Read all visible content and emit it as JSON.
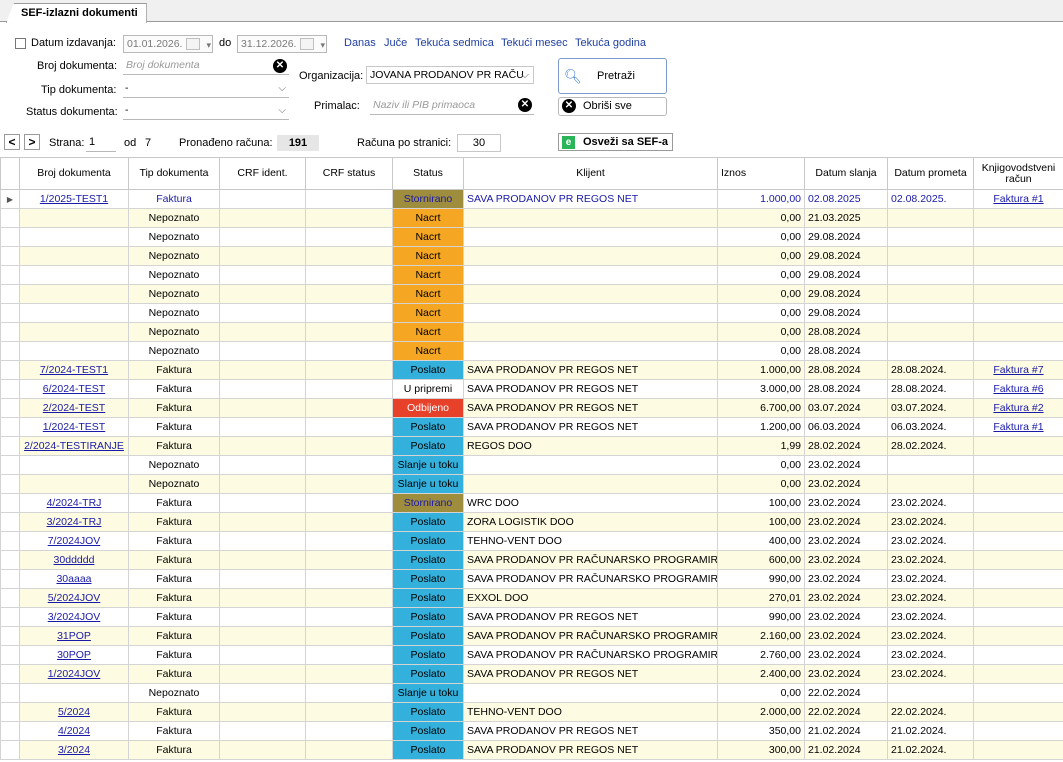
{
  "tab_title": "SEF-izlazni dokumenti",
  "filters": {
    "date_checkbox_label": "Datum izdavanja:",
    "date_from": "01.01.2026.",
    "date_to_label": "do",
    "date_to": "31.12.2026.",
    "quick_links": [
      "Danas",
      "Juče",
      "Tekuća sedmica",
      "Tekući mesec",
      "Tekuća godina"
    ],
    "doc_number_label": "Broj dokumenta:",
    "doc_number_placeholder": "Broj dokumenta",
    "doc_type_label": "Tip dokumenta:",
    "doc_type_value": "-",
    "doc_status_label": "Status dokumenta:",
    "doc_status_value": "-",
    "org_label": "Organizacija:",
    "org_value": "JOVANA PRODANOV PR RAČU",
    "recipient_label": "Primalac:",
    "recipient_placeholder": "Naziv ili PIB primaoca",
    "search_button": "Pretraži",
    "clear_all_button": "Obriši sve"
  },
  "toolbar": {
    "page_label": "Strana:",
    "page_value": "1",
    "of_label": "od",
    "total_pages": "7",
    "found_label": "Pronađeno računa:",
    "found_count": "191",
    "per_page_label": "Računa po stranici:",
    "per_page_value": "30",
    "refresh_button": "Osveži sa SEF-a",
    "colors": {
      "accent": "#1a1aa8",
      "refresh_icon": "#2bb55a"
    }
  },
  "table": {
    "columns": [
      "Broj dokumenta",
      "Tip dokumenta",
      "CRF ident.",
      "CRF status",
      "Status",
      "Klijent",
      "Iznos",
      "Datum slanja",
      "Datum prometa",
      "Knjigovodstveni račun"
    ],
    "status_colors": {
      "Nacrt": "#f5a623",
      "Poslato": "#33b0dc",
      "Stornirano": "#9e8d3c",
      "Odbijeno": "#e8412a",
      "Slanje u toku": "#33b0dc",
      "U pripremi": "#ffffff"
    },
    "rows": [
      {
        "doc": "1/2025-TEST1",
        "type": "Faktura",
        "crf_id": "",
        "crf_status": "",
        "status": "Stornirano",
        "client": "SAVA PRODANOV PR REGOS NET",
        "amount": "1.000,00",
        "sent": "02.08.2025",
        "turnover": "02.08.2025.",
        "account": "Faktura #1"
      },
      {
        "doc": "",
        "type": "Nepoznato",
        "crf_id": "",
        "crf_status": "",
        "status": "Nacrt",
        "client": "",
        "amount": "0,00",
        "sent": "21.03.2025",
        "turnover": "",
        "account": ""
      },
      {
        "doc": "",
        "type": "Nepoznato",
        "crf_id": "",
        "crf_status": "",
        "status": "Nacrt",
        "client": "",
        "amount": "0,00",
        "sent": "29.08.2024",
        "turnover": "",
        "account": ""
      },
      {
        "doc": "",
        "type": "Nepoznato",
        "crf_id": "",
        "crf_status": "",
        "status": "Nacrt",
        "client": "",
        "amount": "0,00",
        "sent": "29.08.2024",
        "turnover": "",
        "account": ""
      },
      {
        "doc": "",
        "type": "Nepoznato",
        "crf_id": "",
        "crf_status": "",
        "status": "Nacrt",
        "client": "",
        "amount": "0,00",
        "sent": "29.08.2024",
        "turnover": "",
        "account": ""
      },
      {
        "doc": "",
        "type": "Nepoznato",
        "crf_id": "",
        "crf_status": "",
        "status": "Nacrt",
        "client": "",
        "amount": "0,00",
        "sent": "29.08.2024",
        "turnover": "",
        "account": ""
      },
      {
        "doc": "",
        "type": "Nepoznato",
        "crf_id": "",
        "crf_status": "",
        "status": "Nacrt",
        "client": "",
        "amount": "0,00",
        "sent": "29.08.2024",
        "turnover": "",
        "account": ""
      },
      {
        "doc": "",
        "type": "Nepoznato",
        "crf_id": "",
        "crf_status": "",
        "status": "Nacrt",
        "client": "",
        "amount": "0,00",
        "sent": "28.08.2024",
        "turnover": "",
        "account": ""
      },
      {
        "doc": "",
        "type": "Nepoznato",
        "crf_id": "",
        "crf_status": "",
        "status": "Nacrt",
        "client": "",
        "amount": "0,00",
        "sent": "28.08.2024",
        "turnover": "",
        "account": ""
      },
      {
        "doc": "7/2024-TEST1",
        "type": "Faktura",
        "crf_id": "",
        "crf_status": "",
        "status": "Poslato",
        "client": "SAVA PRODANOV PR REGOS NET",
        "amount": "1.000,00",
        "sent": "28.08.2024",
        "turnover": "28.08.2024.",
        "account": "Faktura #7"
      },
      {
        "doc": "6/2024-TEST",
        "type": "Faktura",
        "crf_id": "",
        "crf_status": "",
        "status": "U pripremi",
        "client": "SAVA PRODANOV PR REGOS NET",
        "amount": "3.000,00",
        "sent": "28.08.2024",
        "turnover": "28.08.2024.",
        "account": "Faktura #6"
      },
      {
        "doc": "2/2024-TEST",
        "type": "Faktura",
        "crf_id": "",
        "crf_status": "",
        "status": "Odbijeno",
        "client": "SAVA PRODANOV PR REGOS NET",
        "amount": "6.700,00",
        "sent": "03.07.2024",
        "turnover": "03.07.2024.",
        "account": "Faktura #2"
      },
      {
        "doc": "1/2024-TEST",
        "type": "Faktura",
        "crf_id": "",
        "crf_status": "",
        "status": "Poslato",
        "client": "SAVA PRODANOV PR REGOS NET",
        "amount": "1.200,00",
        "sent": "06.03.2024",
        "turnover": "06.03.2024.",
        "account": "Faktura #1"
      },
      {
        "doc": "2/2024-TESTIRANJE",
        "type": "Faktura",
        "crf_id": "",
        "crf_status": "",
        "status": "Poslato",
        "client": "REGOS DOO",
        "amount": "1,99",
        "sent": "28.02.2024",
        "turnover": "28.02.2024.",
        "account": ""
      },
      {
        "doc": "",
        "type": "Nepoznato",
        "crf_id": "",
        "crf_status": "",
        "status": "Slanje u toku",
        "client": "",
        "amount": "0,00",
        "sent": "23.02.2024",
        "turnover": "",
        "account": ""
      },
      {
        "doc": "",
        "type": "Nepoznato",
        "crf_id": "",
        "crf_status": "",
        "status": "Slanje u toku",
        "client": "",
        "amount": "0,00",
        "sent": "23.02.2024",
        "turnover": "",
        "account": ""
      },
      {
        "doc": "4/2024-TRJ",
        "type": "Faktura",
        "crf_id": "",
        "crf_status": "",
        "status": "Stornirano",
        "client": "WRC DOO",
        "amount": "100,00",
        "sent": "23.02.2024",
        "turnover": "23.02.2024.",
        "account": ""
      },
      {
        "doc": "3/2024-TRJ",
        "type": "Faktura",
        "crf_id": "",
        "crf_status": "",
        "status": "Poslato",
        "client": "ZORA LOGISTIK DOO",
        "amount": "100,00",
        "sent": "23.02.2024",
        "turnover": "23.02.2024.",
        "account": ""
      },
      {
        "doc": "7/2024JOV",
        "type": "Faktura",
        "crf_id": "",
        "crf_status": "",
        "status": "Poslato",
        "client": "TEHNO-VENT DOO",
        "amount": "400,00",
        "sent": "23.02.2024",
        "turnover": "23.02.2024.",
        "account": ""
      },
      {
        "doc": "30ddddd",
        "type": "Faktura",
        "crf_id": "",
        "crf_status": "",
        "status": "Poslato",
        "client": "SAVA PRODANOV PR RAČUNARSKO PROGRAMIR...",
        "amount": "600,00",
        "sent": "23.02.2024",
        "turnover": "23.02.2024.",
        "account": ""
      },
      {
        "doc": "30aaaa",
        "type": "Faktura",
        "crf_id": "",
        "crf_status": "",
        "status": "Poslato",
        "client": "SAVA PRODANOV PR RAČUNARSKO PROGRAMIR...",
        "amount": "990,00",
        "sent": "23.02.2024",
        "turnover": "23.02.2024.",
        "account": ""
      },
      {
        "doc": "5/2024JOV",
        "type": "Faktura",
        "crf_id": "",
        "crf_status": "",
        "status": "Poslato",
        "client": "EXXOL DOO",
        "amount": "270,01",
        "sent": "23.02.2024",
        "turnover": "23.02.2024.",
        "account": ""
      },
      {
        "doc": "3/2024JOV",
        "type": "Faktura",
        "crf_id": "",
        "crf_status": "",
        "status": "Poslato",
        "client": "SAVA PRODANOV PR REGOS NET",
        "amount": "990,00",
        "sent": "23.02.2024",
        "turnover": "23.02.2024.",
        "account": ""
      },
      {
        "doc": "31POP",
        "type": "Faktura",
        "crf_id": "",
        "crf_status": "",
        "status": "Poslato",
        "client": "SAVA PRODANOV PR RAČUNARSKO PROGRAMIR...",
        "amount": "2.160,00",
        "sent": "23.02.2024",
        "turnover": "23.02.2024.",
        "account": ""
      },
      {
        "doc": "30POP",
        "type": "Faktura",
        "crf_id": "",
        "crf_status": "",
        "status": "Poslato",
        "client": "SAVA PRODANOV PR RAČUNARSKO PROGRAMIR...",
        "amount": "2.760,00",
        "sent": "23.02.2024",
        "turnover": "23.02.2024.",
        "account": ""
      },
      {
        "doc": "1/2024JOV",
        "type": "Faktura",
        "crf_id": "",
        "crf_status": "",
        "status": "Poslato",
        "client": "SAVA PRODANOV PR REGOS NET",
        "amount": "2.400,00",
        "sent": "23.02.2024",
        "turnover": "23.02.2024.",
        "account": ""
      },
      {
        "doc": "",
        "type": "Nepoznato",
        "crf_id": "",
        "crf_status": "",
        "status": "Slanje u toku",
        "client": "",
        "amount": "0,00",
        "sent": "22.02.2024",
        "turnover": "",
        "account": ""
      },
      {
        "doc": "5/2024",
        "type": "Faktura",
        "crf_id": "",
        "crf_status": "",
        "status": "Poslato",
        "client": "TEHNO-VENT DOO",
        "amount": "2.000,00",
        "sent": "22.02.2024",
        "turnover": "22.02.2024.",
        "account": ""
      },
      {
        "doc": "4/2024",
        "type": "Faktura",
        "crf_id": "",
        "crf_status": "",
        "status": "Poslato",
        "client": "SAVA PRODANOV PR REGOS NET",
        "amount": "350,00",
        "sent": "21.02.2024",
        "turnover": "21.02.2024.",
        "account": ""
      },
      {
        "doc": "3/2024",
        "type": "Faktura",
        "crf_id": "",
        "crf_status": "",
        "status": "Poslato",
        "client": "SAVA PRODANOV PR REGOS NET",
        "amount": "300,00",
        "sent": "21.02.2024",
        "turnover": "21.02.2024.",
        "account": ""
      }
    ]
  }
}
